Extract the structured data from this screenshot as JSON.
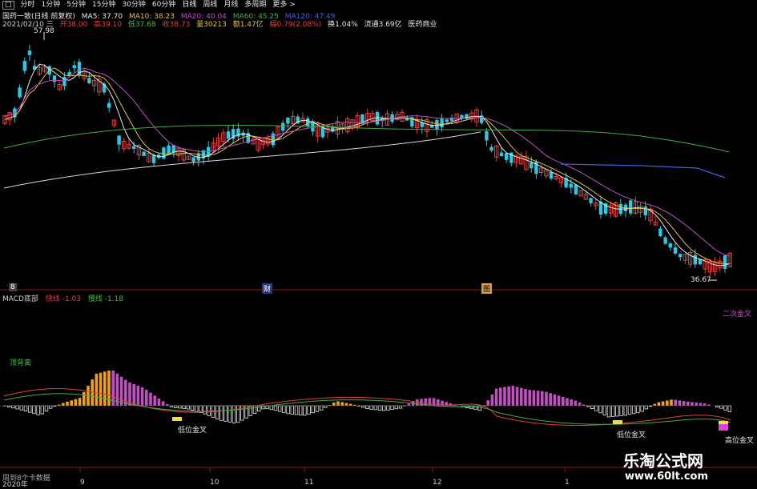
{
  "toolbar": {
    "items": [
      "□",
      "分时",
      "1分钟",
      "5分钟",
      "15分钟",
      "30分钟",
      "60分钟",
      "日线",
      "周线",
      "月线",
      "多周期",
      "更多 >"
    ]
  },
  "info": {
    "stock": "国药一致(日线 前复权)",
    "ma5": "MA5: 37.70",
    "ma10": "MA10: 38.23",
    "ma20": "MA20: 40.04",
    "ma60": "MA60: 45.25",
    "ma120": "MA120: 47.49",
    "date": "2021/02/10 三",
    "open": "开38.00",
    "high": "高39.10",
    "low": "低37.68",
    "close": "收38.73",
    "volume": "量30213",
    "amount": "额1.47亿",
    "change": "幅0.79(2.08%)",
    "turnover": "换1.04%",
    "float": "流通3.69亿",
    "industry": "医药商业"
  },
  "price_labels": {
    "high_mark": "57.98",
    "low_mark": "36.67"
  },
  "markers": {
    "m1": "8",
    "m2": "财",
    "m3": "图"
  },
  "macd": {
    "title": "MACD底部",
    "fast": "快线 -1.03",
    "slow": "慢线 -1.18",
    "label_divergence": "顶背离",
    "label_low_cross_1": "低位金叉",
    "label_low_cross_2": "低位金叉",
    "label_second_cross": "二次金叉",
    "label_high_cross": "高位金叉"
  },
  "xaxis": {
    "labels": [
      "2020年",
      "9",
      "10",
      "11",
      "12",
      "1"
    ]
  },
  "footer": "周到8个卡数据",
  "watermark": {
    "title": "乐淘公式网",
    "url": "www.60lt.com"
  },
  "colors": {
    "up": "#e04040",
    "down": "#2ec8e0",
    "ma5": "#e8e8e8",
    "ma10": "#e0c040",
    "ma20": "#c050c0",
    "ma60": "#40b040",
    "ma120": "#4060e0",
    "hist_pos": "#f0a020",
    "hist_neg": "#e8e8e8"
  }
}
